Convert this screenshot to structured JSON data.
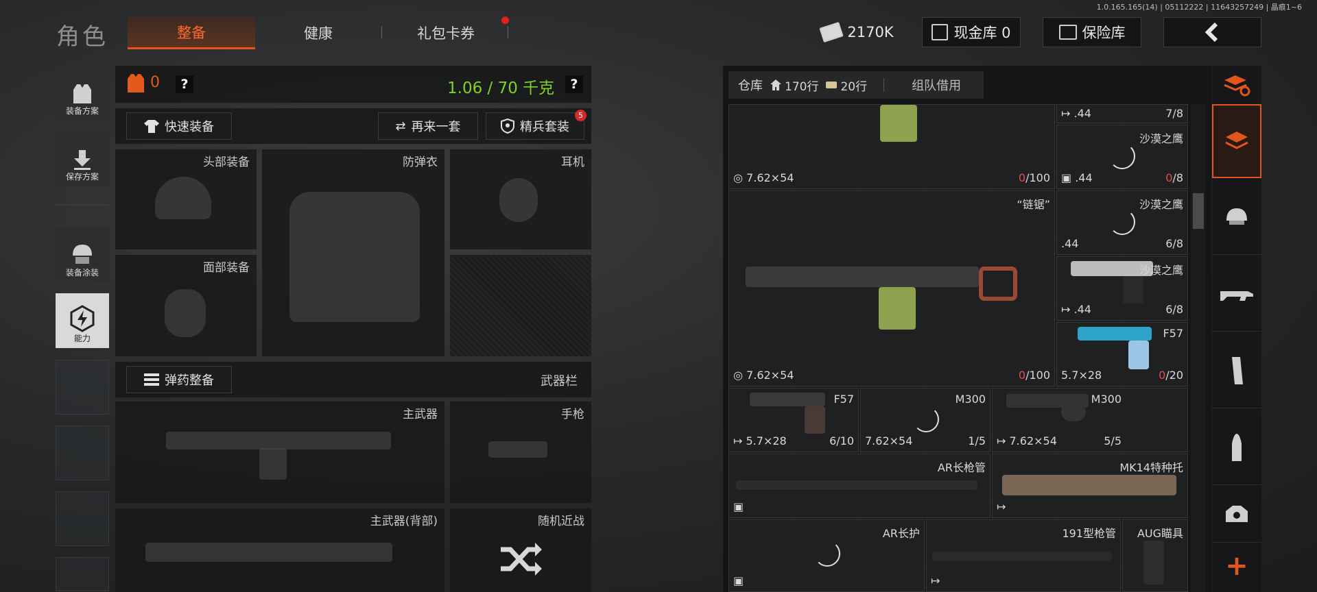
{
  "version": "1.0.165.165(14) | 05112222 | 11643257249 | 晶痕1~6",
  "page_title": "角色",
  "tabs": [
    {
      "label": "整备",
      "active": true
    },
    {
      "label": "健康"
    },
    {
      "label": "礼包卡券",
      "has_dot": true
    }
  ],
  "currency": {
    "value": "2170K",
    "icon": "cash-icon"
  },
  "cash_vault": {
    "label": "现金库 0",
    "icon": "vault-icon"
  },
  "safe": {
    "label": "保险库",
    "icon": "safe-icon"
  },
  "back": {
    "icon": "back-arrow-icon"
  },
  "sidebar": [
    {
      "label": "装备方案",
      "icon": "vest-icon"
    },
    {
      "label": "保存方案",
      "icon": "download-icon"
    },
    {
      "label": "装备涂装",
      "icon": "helmet-paint-icon"
    },
    {
      "label": "能力",
      "icon": "ability-icon",
      "active": true
    }
  ],
  "armor_count": "0",
  "weight": "1.06 / 70 千克",
  "help": "?",
  "buttons": {
    "quick_equip": "快速装备",
    "again": "再来一套",
    "elite": "精兵套装",
    "elite_badge": "5",
    "ammo": "弹药整备"
  },
  "slots": {
    "head": "头部装备",
    "vest": "防弹衣",
    "headset": "耳机",
    "face": "面部装备",
    "weapon_bar": "武器栏",
    "primary": "主武器",
    "pistol": "手枪",
    "primary_back": "主武器(背部)",
    "melee": "随机近战"
  },
  "warehouse": {
    "tab": "仓库",
    "rows_home": "170行",
    "rows_ammo": "20行",
    "team_tab": "组队借用"
  },
  "items": [
    {
      "id": "top-mg",
      "name": "",
      "caliber": "7.62×54",
      "count_cur": "0",
      "count_max": "/100"
    },
    {
      "id": "r1",
      "caliber": ".44",
      "count": "7/8"
    },
    {
      "id": "r2",
      "name": "沙漠之鹰",
      "caliber": ".44",
      "count_cur": "0",
      "count_max": "/8"
    },
    {
      "id": "mg",
      "name": "“链锯”",
      "caliber": "7.62×54",
      "count_cur": "0",
      "count_max": "/100"
    },
    {
      "id": "r3",
      "name": "沙漠之鹰",
      "caliber": ".44",
      "count": "6/8"
    },
    {
      "id": "r4",
      "name": "沙漠之鹰",
      "caliber": ".44",
      "count": "6/8"
    },
    {
      "id": "r5",
      "name": "F57",
      "caliber": "5.7×28",
      "count_cur": "0",
      "count_max": "/20"
    },
    {
      "id": "r6",
      "name": "F57",
      "caliber": "5.7×28",
      "count": "6/10"
    },
    {
      "id": "r7",
      "name": "M300",
      "caliber": "7.62×54",
      "count": "1/5"
    },
    {
      "id": "r8",
      "name": "M300",
      "caliber": "7.62×54",
      "count": "5/5"
    },
    {
      "id": "r9",
      "name": "AR长枪管"
    },
    {
      "id": "r10",
      "name": "MK14特种托"
    },
    {
      "id": "r11",
      "name": "AR长护"
    },
    {
      "id": "r12",
      "name": "191型枪管"
    },
    {
      "id": "r13",
      "name": "AUG瞄具"
    }
  ],
  "right_rail": {
    "add": "+"
  },
  "colors": {
    "accent": "#e2551c",
    "weight": "#7ed321",
    "red": "#e54a4a"
  }
}
